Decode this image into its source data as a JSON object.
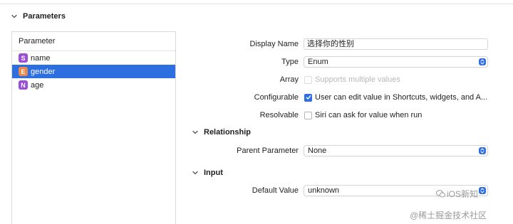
{
  "parameters_section": {
    "title": "Parameters"
  },
  "parameter_list": {
    "header": "Parameter",
    "items": [
      {
        "badge": "S",
        "name": "name",
        "badge_color": "#9b4fd6",
        "selected": false
      },
      {
        "badge": "E",
        "name": "gender",
        "badge_color": "#e9884a",
        "selected": true
      },
      {
        "badge": "N",
        "name": "age",
        "badge_color": "#9b4fd6",
        "selected": false
      }
    ]
  },
  "form": {
    "display_name": {
      "label": "Display Name",
      "value": "选择你的性别"
    },
    "type": {
      "label": "Type",
      "value": "Enum"
    },
    "array": {
      "label": "Array",
      "checkbox_label": "Supports multiple values",
      "checked": false,
      "disabled": true
    },
    "configurable": {
      "label": "Configurable",
      "checkbox_label": "User can edit value in Shortcuts, widgets, and A...",
      "checked": true
    },
    "resolvable": {
      "label": "Resolvable",
      "checkbox_label": "Siri can ask for value when run",
      "checked": false
    }
  },
  "relationship_section": {
    "title": "Relationship",
    "parent_parameter": {
      "label": "Parent Parameter",
      "value": "None"
    }
  },
  "input_section": {
    "title": "Input",
    "default_value": {
      "label": "Default Value",
      "value": "unknown"
    }
  },
  "watermark": {
    "line1": "iOS新知",
    "line2": "@稀土掘金技术社区"
  },
  "colors": {
    "accent": "#2d6ee0",
    "string_badge": "#9b4fd6",
    "enum_badge": "#e9884a"
  }
}
